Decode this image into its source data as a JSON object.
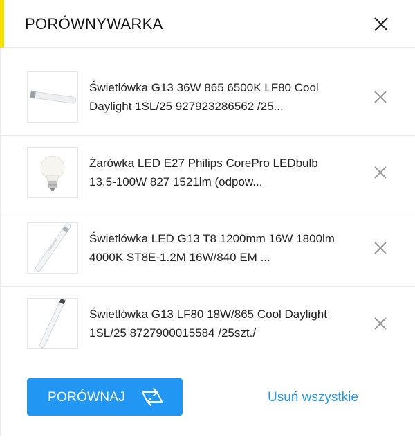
{
  "header": {
    "title": "PORÓWNYWARKA",
    "close_icon": "close-icon",
    "accent_color": "#f5e000"
  },
  "products": [
    {
      "name": "Świetlówka G13 36W 865 6500K LF80 Cool Daylight 1SL/25 927923286562 /25...",
      "image": "fluorescent-tube-image",
      "remove_icon": "close-icon"
    },
    {
      "name": "Żarówka LED E27 Philips CorePro LEDbulb 13.5-100W 827 1521lm (odpow...",
      "image": "led-bulb-image",
      "remove_icon": "close-icon"
    },
    {
      "name": "Świetlówka LED G13 T8 1200mm 16W 1800lm 4000K ST8E-1.2M 16W/840 EM ...",
      "image": "led-tube-image",
      "remove_icon": "close-icon"
    },
    {
      "name": "Świetlówka G13 LF80 18W/865 Cool Daylight 1SL/25 8727900015584 /25szt./",
      "image": "fluorescent-tube-image",
      "remove_icon": "close-icon"
    }
  ],
  "footer": {
    "compare_label": "PORÓWNAJ",
    "compare_icon": "swap-arrows-icon",
    "remove_all_label": "Usuń wszystkie",
    "primary_color": "#2196f3"
  }
}
